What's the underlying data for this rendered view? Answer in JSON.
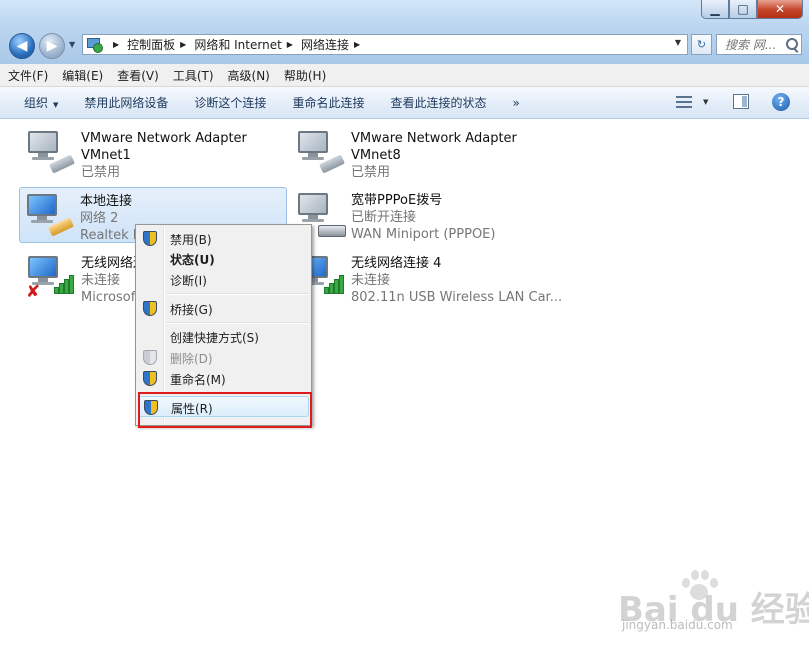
{
  "address": {
    "crumbs": [
      "控制面板",
      "网络和 Internet",
      "网络连接"
    ],
    "search_placeholder": "搜索 网..."
  },
  "menubar": [
    "文件(F)",
    "编辑(E)",
    "查看(V)",
    "工具(T)",
    "高级(N)",
    "帮助(H)"
  ],
  "toolbar": {
    "organize": "组织",
    "disable": "禁用此网络设备",
    "diagnose": "诊断这个连接",
    "rename": "重命名此连接",
    "view_status": "查看此连接的状态",
    "more": "»"
  },
  "connections": [
    {
      "name": "VMware Network Adapter",
      "line2": "VMnet1",
      "line3": "已禁用"
    },
    {
      "name": "VMware Network Adapter",
      "line2": "VMnet8",
      "line3": "已禁用"
    },
    {
      "name": "本地连接",
      "line2": "网络 2",
      "line3": "Realtek PC"
    },
    {
      "name": "宽带PPPoE拨号",
      "line2": "已断开连接",
      "line3": "WAN Miniport (PPPOE)"
    },
    {
      "name": "无线网络连",
      "line2": "未连接",
      "line3": "Microsoft"
    },
    {
      "name": "无线网络连接 4",
      "line2": "未连接",
      "line3": "802.11n USB Wireless LAN Car..."
    }
  ],
  "context_menu": {
    "disable": "禁用(B)",
    "status": "状态(U)",
    "diagnose": "诊断(I)",
    "bridge": "桥接(G)",
    "shortcut": "创建快捷方式(S)",
    "delete": "删除(D)",
    "rename": "重命名(M)",
    "properties": "属性(R)"
  },
  "watermark": {
    "brand": "Bai du 经验",
    "url": "jingyan.baidu.com"
  },
  "colors": {
    "highlight_box": "#e01b1b",
    "selection": "#cfe3f8"
  }
}
